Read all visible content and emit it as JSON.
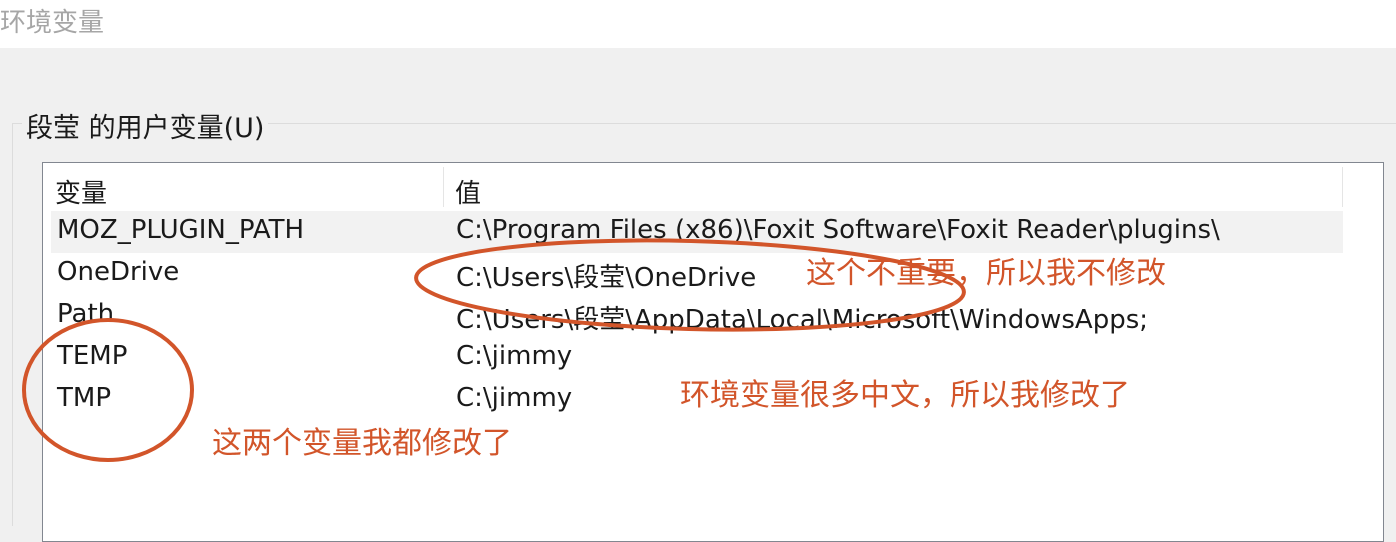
{
  "window": {
    "title": "环境变量"
  },
  "user_variables": {
    "group_label": "段莹 的用户变量(U)",
    "columns": [
      "变量",
      "值"
    ],
    "rows": [
      {
        "name": "MOZ_PLUGIN_PATH",
        "value": "C:\\Program Files (x86)\\Foxit Software\\Foxit Reader\\plugins\\"
      },
      {
        "name": "OneDrive",
        "value": "C:\\Users\\段莹\\OneDrive"
      },
      {
        "name": "Path",
        "value": "C:\\Users\\段莹\\AppData\\Local\\Microsoft\\WindowsApps;"
      },
      {
        "name": "TEMP",
        "value": "C:\\jimmy"
      },
      {
        "name": "TMP",
        "value": "C:\\jimmy"
      }
    ]
  },
  "annotations": {
    "not_important": "这个不重要，所以我不修改",
    "many_chinese": "环境变量很多中文，所以我修改了",
    "both_changed": "这两个变量我都修改了",
    "color": "#d2552a"
  }
}
